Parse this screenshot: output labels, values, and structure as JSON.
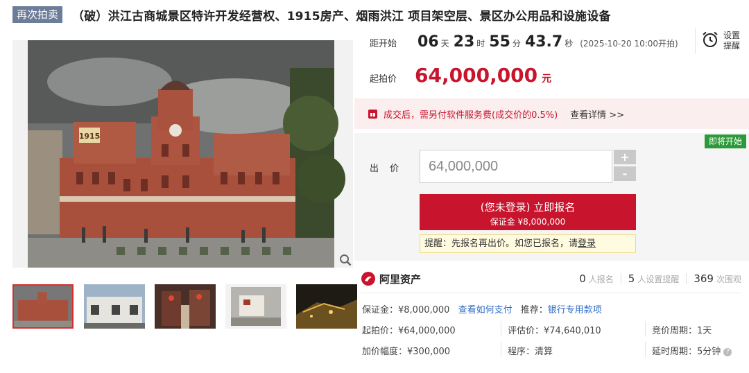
{
  "header": {
    "tag": "再次拍卖",
    "title": "（破）洪江古商城景区特许开发经营权、1915房产、烟雨洪江 项目架空层、景区办公用品和设施设备"
  },
  "countdown": {
    "label": "距开始",
    "days": "06",
    "days_unit": "天",
    "hours": "23",
    "hours_unit": "时",
    "minutes": "55",
    "minutes_unit": "分",
    "seconds": "43.7",
    "seconds_unit": "秒",
    "start_time": "(2025-10-20 10:00开拍)"
  },
  "reminder": {
    "label": "设置提醒",
    "icon": "alarm-clock-icon"
  },
  "start_price": {
    "label": "起拍价",
    "value": "64,000,000",
    "unit": "元"
  },
  "notice": {
    "text": "成交后，需另付软件服务费(成交价的0.5%)",
    "link": "查看详情 >>"
  },
  "bid": {
    "badge": "即将开始",
    "label": "出 价",
    "amount": "64,000,000",
    "plus": "+",
    "minus": "-",
    "register_main": "(您未登录) 立即报名",
    "register_sub": "保证金 ¥8,000,000",
    "tip_prefix": "提醒：先报名再出价。如您已报名，请",
    "tip_login": "登录"
  },
  "platform": {
    "name": "阿里资产"
  },
  "stats": [
    {
      "num": "0",
      "label": "人报名"
    },
    {
      "num": "5",
      "label": "人设置提醒"
    },
    {
      "num": "369",
      "label": "次围观"
    }
  ],
  "info": {
    "deposit": "保证金：¥8,000,000",
    "how_to_pay": "查看如何支付",
    "recommend_label": "推荐：",
    "recommend_link": "银行专用款项",
    "start_price": "起拍价：¥64,000,000",
    "appraisal": "评估价：¥74,640,010",
    "cycle": "竞价周期：1天",
    "increment": "加价幅度：¥300,000",
    "procedure": "程序：清算",
    "delay": "延时周期：5分钟"
  },
  "gallery": {
    "building_sign": "1915"
  },
  "colors": {
    "accent": "#c8142c",
    "tag_bg": "#6b7d98",
    "badge": "#2c9a3a",
    "link": "#2e6bc6"
  }
}
